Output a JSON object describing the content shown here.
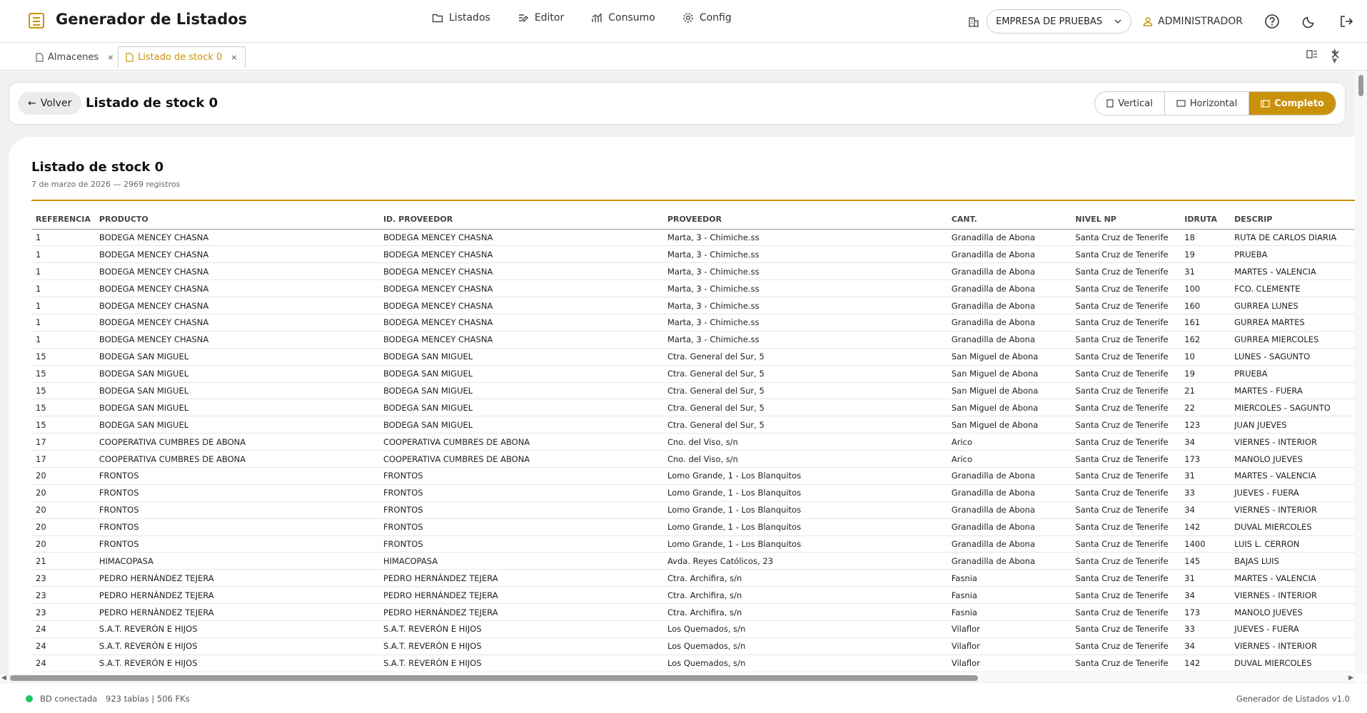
{
  "app": {
    "title": "Generador de Listados"
  },
  "nav": [
    {
      "label": "Listados",
      "icon": "folder-icon"
    },
    {
      "label": "Editor",
      "icon": "edit-icon"
    },
    {
      "label": "Consumo",
      "icon": "chart-icon"
    },
    {
      "label": "Config",
      "icon": "gear-icon"
    }
  ],
  "header": {
    "company": "EMPRESA DE PRUEBAS",
    "user": "ADMINISTRADOR"
  },
  "tabs": [
    {
      "label": "Almacenes",
      "close": "×"
    },
    {
      "label": "Listado de stock 0",
      "close": "×"
    }
  ],
  "page": {
    "back_label": "Volver",
    "title": "Listado de stock 0",
    "views": [
      "Vertical",
      "Horizontal",
      "Completo"
    ],
    "active_view": "Completo"
  },
  "report": {
    "title": "Listado de stock 0",
    "subtitle": "7 de marzo de 2026 — 2969 registros",
    "columns": [
      "REFERENCIA",
      "PRODUCTO",
      "ID. PROVEEDOR",
      "PROVEEDOR",
      "CANT.",
      "NIVEL NP",
      "IDRUTA",
      "DESCRIP"
    ],
    "rows": [
      [
        "1",
        "BODEGA MENCEY CHASNA",
        "BODEGA MENCEY CHASNA",
        "Marta, 3 - Chimiche.ss",
        "Granadilla de Abona",
        "Santa Cruz de Tenerife",
        "18",
        "RUTA DE CARLOS DIARIA"
      ],
      [
        "1",
        "BODEGA MENCEY CHASNA",
        "BODEGA MENCEY CHASNA",
        "Marta, 3 - Chimiche.ss",
        "Granadilla de Abona",
        "Santa Cruz de Tenerife",
        "19",
        "PRUEBA"
      ],
      [
        "1",
        "BODEGA MENCEY CHASNA",
        "BODEGA MENCEY CHASNA",
        "Marta, 3 - Chimiche.ss",
        "Granadilla de Abona",
        "Santa Cruz de Tenerife",
        "31",
        "MARTES - VALENCIA"
      ],
      [
        "1",
        "BODEGA MENCEY CHASNA",
        "BODEGA MENCEY CHASNA",
        "Marta, 3 - Chimiche.ss",
        "Granadilla de Abona",
        "Santa Cruz de Tenerife",
        "100",
        "FCO. CLEMENTE"
      ],
      [
        "1",
        "BODEGA MENCEY CHASNA",
        "BODEGA MENCEY CHASNA",
        "Marta, 3 - Chimiche.ss",
        "Granadilla de Abona",
        "Santa Cruz de Tenerife",
        "160",
        "GURREA LUNES"
      ],
      [
        "1",
        "BODEGA MENCEY CHASNA",
        "BODEGA MENCEY CHASNA",
        "Marta, 3 - Chimiche.ss",
        "Granadilla de Abona",
        "Santa Cruz de Tenerife",
        "161",
        "GURREA MARTES"
      ],
      [
        "1",
        "BODEGA MENCEY CHASNA",
        "BODEGA MENCEY CHASNA",
        "Marta, 3 - Chimiche.ss",
        "Granadilla de Abona",
        "Santa Cruz de Tenerife",
        "162",
        "GURREA MIERCOLES"
      ],
      [
        "15",
        "BODEGA SAN MIGUEL",
        "BODEGA SAN MIGUEL",
        "Ctra. General del Sur, 5",
        "San Miguel de Abona",
        "Santa Cruz de Tenerife",
        "10",
        "LUNES - SAGUNTO"
      ],
      [
        "15",
        "BODEGA SAN MIGUEL",
        "BODEGA SAN MIGUEL",
        "Ctra. General del Sur, 5",
        "San Miguel de Abona",
        "Santa Cruz de Tenerife",
        "19",
        "PRUEBA"
      ],
      [
        "15",
        "BODEGA SAN MIGUEL",
        "BODEGA SAN MIGUEL",
        "Ctra. General del Sur, 5",
        "San Miguel de Abona",
        "Santa Cruz de Tenerife",
        "21",
        "MARTES - FUERA"
      ],
      [
        "15",
        "BODEGA SAN MIGUEL",
        "BODEGA SAN MIGUEL",
        "Ctra. General del Sur, 5",
        "San Miguel de Abona",
        "Santa Cruz de Tenerife",
        "22",
        "MIERCOLES - SAGUNTO"
      ],
      [
        "15",
        "BODEGA SAN MIGUEL",
        "BODEGA SAN MIGUEL",
        "Ctra. General del Sur, 5",
        "San Miguel de Abona",
        "Santa Cruz de Tenerife",
        "123",
        "JUAN JUEVES"
      ],
      [
        "17",
        "COOPERATIVA CUMBRES DE ABONA",
        "COOPERATIVA CUMBRES DE ABONA",
        "Cno. del Viso, s/n",
        "Arico",
        "Santa Cruz de Tenerife",
        "34",
        "VIERNES - INTERIOR"
      ],
      [
        "17",
        "COOPERATIVA CUMBRES DE ABONA",
        "COOPERATIVA CUMBRES DE ABONA",
        "Cno. del Viso, s/n",
        "Arico",
        "Santa Cruz de Tenerife",
        "173",
        "MANOLO JUEVES"
      ],
      [
        "20",
        "FRONTOS",
        "FRONTOS",
        "Lomo Grande, 1 - Los Blanquitos",
        "Granadilla de Abona",
        "Santa Cruz de Tenerife",
        "31",
        "MARTES - VALENCIA"
      ],
      [
        "20",
        "FRONTOS",
        "FRONTOS",
        "Lomo Grande, 1 - Los Blanquitos",
        "Granadilla de Abona",
        "Santa Cruz de Tenerife",
        "33",
        "JUEVES - FUERA"
      ],
      [
        "20",
        "FRONTOS",
        "FRONTOS",
        "Lomo Grande, 1 - Los Blanquitos",
        "Granadilla de Abona",
        "Santa Cruz de Tenerife",
        "34",
        "VIERNES - INTERIOR"
      ],
      [
        "20",
        "FRONTOS",
        "FRONTOS",
        "Lomo Grande, 1 - Los Blanquitos",
        "Granadilla de Abona",
        "Santa Cruz de Tenerife",
        "142",
        "DUVAL MIERCOLES"
      ],
      [
        "20",
        "FRONTOS",
        "FRONTOS",
        "Lomo Grande, 1 - Los Blanquitos",
        "Granadilla de Abona",
        "Santa Cruz de Tenerife",
        "1400",
        "LUIS L. CERRON"
      ],
      [
        "21",
        "HIMACOPASA",
        "HIMACOPASA",
        "Avda. Reyes Católicos, 23",
        "Granadilla de Abona",
        "Santa Cruz de Tenerife",
        "145",
        "BAJAS LUIS"
      ],
      [
        "23",
        "PEDRO HERNÁNDEZ TEJERA",
        "PEDRO HERNÁNDEZ TEJERA",
        "Ctra. Archifira, s/n",
        "Fasnia",
        "Santa Cruz de Tenerife",
        "31",
        "MARTES - VALENCIA"
      ],
      [
        "23",
        "PEDRO HERNÁNDEZ TEJERA",
        "PEDRO HERNÁNDEZ TEJERA",
        "Ctra. Archifira, s/n",
        "Fasnia",
        "Santa Cruz de Tenerife",
        "34",
        "VIERNES - INTERIOR"
      ],
      [
        "23",
        "PEDRO HERNÁNDEZ TEJERA",
        "PEDRO HERNÁNDEZ TEJERA",
        "Ctra. Archifira, s/n",
        "Fasnia",
        "Santa Cruz de Tenerife",
        "173",
        "MANOLO JUEVES"
      ],
      [
        "24",
        "S.A.T. REVERÓN E HIJOS",
        "S.A.T. REVERÓN E HIJOS",
        "Los Quemados, s/n",
        "Vilaflor",
        "Santa Cruz de Tenerife",
        "33",
        "JUEVES - FUERA"
      ],
      [
        "24",
        "S.A.T. REVERÓN E HIJOS",
        "S.A.T. REVERÓN E HIJOS",
        "Los Quemados, s/n",
        "Vilaflor",
        "Santa Cruz de Tenerife",
        "34",
        "VIERNES - INTERIOR"
      ],
      [
        "24",
        "S.A.T. REVERÓN E HIJOS",
        "S.A.T. REVERÓN E HIJOS",
        "Los Quemados, s/n",
        "Vilaflor",
        "Santa Cruz de Tenerife",
        "142",
        "DUVAL MIERCOLES"
      ]
    ]
  },
  "footer": {
    "status": "BD conectada",
    "tables": "923 tablas | 506 FKs",
    "version": "Generador de Listados v1.0"
  },
  "colors": {
    "accent": "#c9920a",
    "status_ok": "#22c55e"
  }
}
